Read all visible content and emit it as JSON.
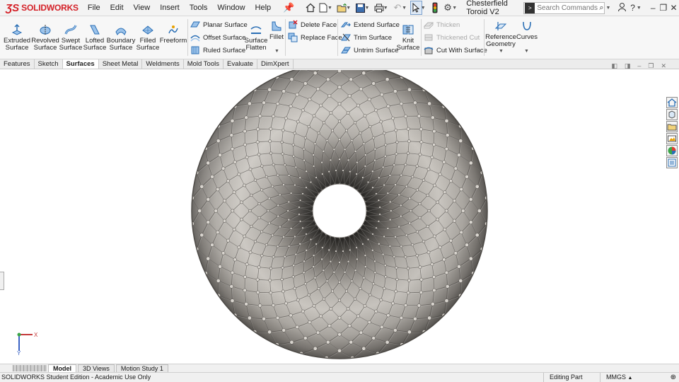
{
  "app": {
    "logo_text": "SOLIDWORKS",
    "document_title": "Chesterfield Toroid V2"
  },
  "menu": [
    "File",
    "Edit",
    "View",
    "Insert",
    "Tools",
    "Window",
    "Help"
  ],
  "search": {
    "placeholder": "Search Commands"
  },
  "ribbon": {
    "large_buttons": [
      {
        "line1": "Extruded",
        "line2": "Surface"
      },
      {
        "line1": "Revolved",
        "line2": "Surface"
      },
      {
        "line1": "Swept",
        "line2": "Surface"
      },
      {
        "line1": "Lofted",
        "line2": "Surface"
      },
      {
        "line1": "Boundary",
        "line2": "Surface"
      },
      {
        "line1": "Filled",
        "line2": "Surface"
      },
      {
        "line1": "Freeform",
        "line2": ""
      }
    ],
    "group2": [
      "Planar Surface",
      "Offset Surface",
      "Ruled Surface"
    ],
    "surface_flatten": {
      "line1": "Surface",
      "line2": "Flatten"
    },
    "fillet": "Fillet",
    "group3": [
      "Delete Face",
      "Replace Face"
    ],
    "group4": [
      "Extend Surface",
      "Trim Surface",
      "Untrim Surface"
    ],
    "knit": {
      "line1": "Knit",
      "line2": "Surface"
    },
    "group5": [
      "Thicken",
      "Thickened Cut",
      "Cut With Surface"
    ],
    "reference_geometry": {
      "line1": "Reference",
      "line2": "Geometry"
    },
    "curves": "Curves"
  },
  "tabs": {
    "items": [
      "Features",
      "Sketch",
      "Surfaces",
      "Sheet Metal",
      "Weldments",
      "Mold Tools",
      "Evaluate",
      "DimXpert"
    ],
    "active": "Surfaces"
  },
  "triad": {
    "x_label": "X",
    "y_label": "Y"
  },
  "bottom_tabs": {
    "items": [
      "Model",
      "3D Views",
      "Motion Study 1"
    ],
    "active": "Model"
  },
  "status": {
    "edition": "SOLIDWORKS Student Edition - Academic Use Only",
    "mode": "Editing Part",
    "units": "MMGS"
  },
  "icons": [
    "ds-logo-icon",
    "pin-icon",
    "home-icon",
    "new-document-icon",
    "open-icon",
    "save-icon",
    "print-icon",
    "undo-icon",
    "select-arrow-icon",
    "traffic-light-icon",
    "options-gear-icon",
    "search-icon",
    "user-icon",
    "help-icon",
    "minimize-icon",
    "restore-icon",
    "close-icon"
  ],
  "colors": {
    "brand_red": "#d42027",
    "accent_blue": "#2b6fb5",
    "model_metal": "#b8b4ae"
  }
}
